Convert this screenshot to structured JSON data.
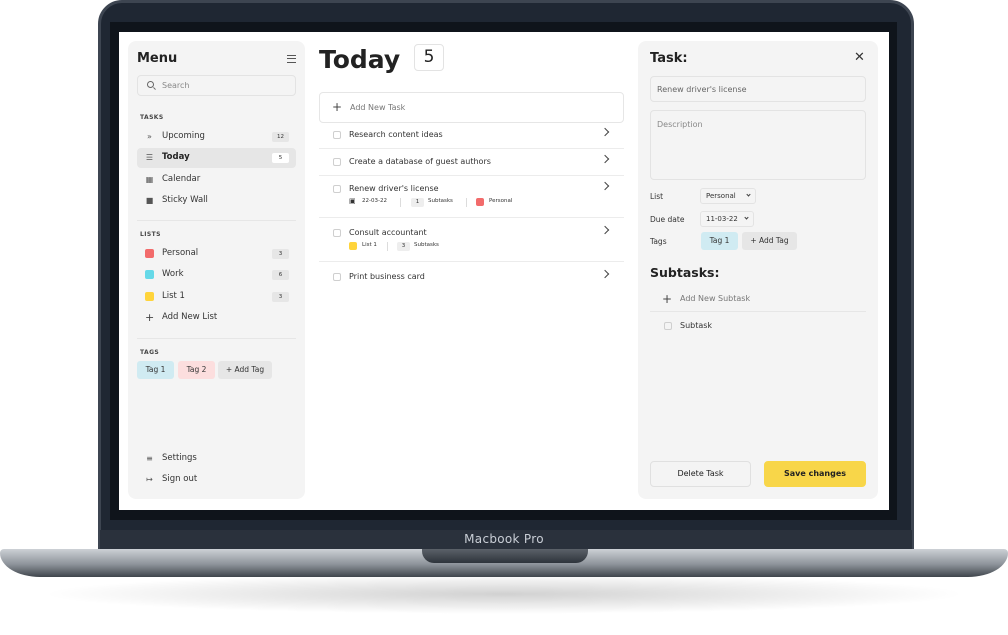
{
  "device": {
    "label": "Macbook Pro"
  },
  "sidebar": {
    "title": "Menu",
    "search_placeholder": "Search",
    "tasks_label": "TASKS",
    "tasks": [
      {
        "label": "Upcoming",
        "count": "12",
        "icon": "double-chevron-right-icon"
      },
      {
        "label": "Today",
        "count": "5",
        "icon": "checklist-icon",
        "active": true
      },
      {
        "label": "Calendar",
        "icon": "calendar-icon"
      },
      {
        "label": "Sticky Wall",
        "icon": "sticky-note-icon"
      }
    ],
    "lists_label": "LISTS",
    "lists": [
      {
        "label": "Personal",
        "count": "3",
        "color": "#f26b6b"
      },
      {
        "label": "Work",
        "count": "6",
        "color": "#66d9e8"
      },
      {
        "label": "List 1",
        "count": "3",
        "color": "#ffd43b"
      }
    ],
    "add_list_label": "Add New List",
    "tags_label": "TAGS",
    "tags": [
      {
        "label": "Tag 1",
        "color": "#d0ebf2"
      },
      {
        "label": "Tag 2",
        "color": "#fcdede"
      }
    ],
    "add_tag_label": "+ Add Tag",
    "settings_label": "Settings",
    "signout_label": "Sign out"
  },
  "main": {
    "title": "Today",
    "count": "5",
    "add_task_label": "Add New Task",
    "tasks": [
      {
        "label": "Research content ideas"
      },
      {
        "label": "Create a database of guest authors"
      },
      {
        "label": "Renew driver's license",
        "date": "22-03-22",
        "subtasks_count": "1",
        "subtasks_label": "Subtasks",
        "list": "Personal",
        "list_color": "#f26b6b"
      },
      {
        "label": "Consult accountant",
        "list": "List 1",
        "list_color": "#ffd43b",
        "subtasks_count": "3",
        "subtasks_label": "Subtasks"
      },
      {
        "label": "Print business card"
      }
    ]
  },
  "task_panel": {
    "title": "Task:",
    "close_icon": "close-icon",
    "name_value": "Renew driver's license",
    "description_placeholder": "Description",
    "list_label": "List",
    "list_value": "Personal",
    "due_label": "Due date",
    "due_value": "11-03-22",
    "tags_label": "Tags",
    "tag_value": "Tag 1",
    "add_tag_label": "+ Add Tag",
    "subtasks_title": "Subtasks:",
    "add_subtask_label": "Add New Subtask",
    "subtask_item": "Subtask",
    "delete_label": "Delete Task",
    "save_label": "Save changes"
  },
  "colors": {
    "accent_yellow": "#f8d649",
    "panel_bg": "#f4f4f4"
  }
}
